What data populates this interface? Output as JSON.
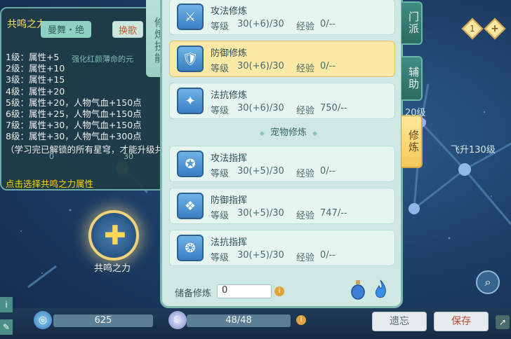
{
  "tooltip": {
    "title": "共鸣之力",
    "skill_name": "曼舞・绝",
    "skill_action": "换歌",
    "skill_desc": "强化红颜薄命的元",
    "levels": [
      "1级：属性+5",
      "2级：属性+10",
      "3级：属性+15",
      "4级：属性+20",
      "5级：属性+20，人物气血+150点",
      "6级：属性+25，人物气血+150点",
      "7级：属性+30，人物气血+150点",
      "8级：属性+30，人物气血+300点"
    ],
    "note": "（学习完已解锁的所有星穹，才能升级共鸣之力）",
    "bg_numbers": [
      "0",
      "30"
    ],
    "click_hint": "点击选择共鸣之力属性"
  },
  "left_tab": {
    "label": "修炼技能"
  },
  "cultivation": {
    "rows": [
      {
        "name": "攻法修炼",
        "level_label": "等级",
        "level": "30(+6)/30",
        "exp_label": "经验",
        "exp": "0/--",
        "icon": "sword-icon",
        "active": false
      },
      {
        "name": "防御修炼",
        "level_label": "等级",
        "level": "30(+6)/30",
        "exp_label": "经验",
        "exp": "0/--",
        "icon": "shield-icon",
        "active": true
      },
      {
        "name": "法抗修炼",
        "level_label": "等级",
        "level": "30(+6)/30",
        "exp_label": "经验",
        "exp": "750/--",
        "icon": "magic-shield-icon",
        "active": false
      }
    ],
    "pet_section_title": "宠物修炼",
    "pet_rows": [
      {
        "name": "攻法指挥",
        "level_label": "等级",
        "level": "30(+5)/30",
        "exp_label": "经验",
        "exp": "0/--",
        "icon": "pet-attack-icon"
      },
      {
        "name": "防御指挥",
        "level_label": "等级",
        "level": "30(+5)/30",
        "exp_label": "经验",
        "exp": "747/--",
        "icon": "pet-defense-icon"
      },
      {
        "name": "法抗指挥",
        "level_label": "等级",
        "level": "30(+5)/30",
        "exp_label": "经验",
        "exp": "0/--",
        "icon": "pet-resist-icon"
      }
    ],
    "reserve_label": "储备修炼",
    "reserve_value": "0"
  },
  "right_tabs": [
    {
      "label": "门派",
      "active": false
    },
    {
      "label": "辅助",
      "active": false
    },
    {
      "label": "修炼",
      "active": true
    }
  ],
  "starmap": {
    "level_text": "20级",
    "fly_text": "飞升130级",
    "resonance_label": "共鸣之力"
  },
  "badges": {
    "count": "1",
    "plus": "+"
  },
  "bottom": {
    "resource1_value": "625",
    "resource2_value": "48/48",
    "forget_label": "遗忘",
    "save_label": "保存"
  },
  "colors": {
    "panel_bg": "#cfe9e2",
    "active_row": "#fbe9a6",
    "highlight_text": "#ffd700",
    "save_text": "#c0482f"
  }
}
